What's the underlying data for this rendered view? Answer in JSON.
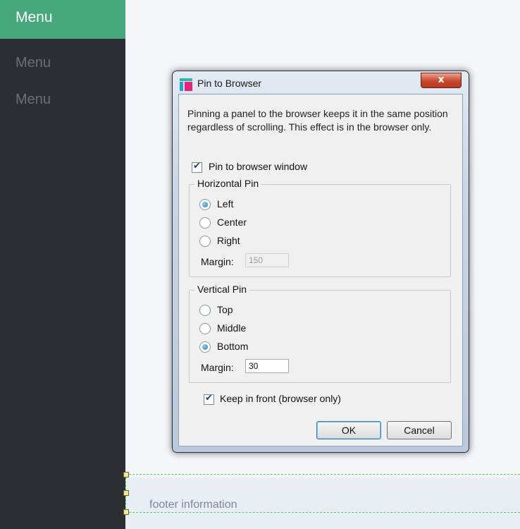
{
  "sidebar": {
    "header_label": "Menu",
    "items": [
      {
        "label": "Menu"
      },
      {
        "label": "Menu"
      }
    ]
  },
  "footer": {
    "text": "footer information"
  },
  "dialog": {
    "title": "Pin to Browser",
    "close_glyph": "x",
    "description": "Pinning a panel to the browser keeps it in the same position regardless of scrolling. This effect is in the browser only.",
    "pin_to_browser": {
      "label": "Pin to browser window",
      "checked": true
    },
    "horizontal_pin": {
      "title": "Horizontal Pin",
      "options": [
        {
          "label": "Left",
          "selected": true
        },
        {
          "label": "Center",
          "selected": false
        },
        {
          "label": "Right",
          "selected": false
        }
      ],
      "margin_label": "Margin:",
      "margin_value": "150"
    },
    "vertical_pin": {
      "title": "Vertical Pin",
      "options": [
        {
          "label": "Top",
          "selected": false
        },
        {
          "label": "Middle",
          "selected": false
        },
        {
          "label": "Bottom",
          "selected": true
        }
      ],
      "margin_label": "Margin:",
      "margin_value": "30"
    },
    "keep_in_front": {
      "label": "Keep in front (browser only)",
      "checked": true
    },
    "ok_label": "OK",
    "cancel_label": "Cancel"
  },
  "colors": {
    "sidebar_bg": "#2b2e33",
    "sidebar_header_bg": "#46a97e",
    "guide_line": "#4fd24f"
  }
}
